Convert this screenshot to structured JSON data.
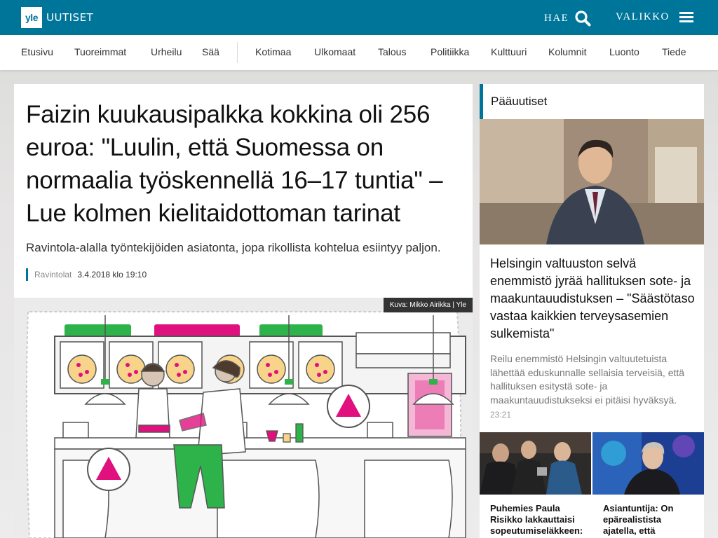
{
  "header": {
    "logo_badge": "yle",
    "logo_text": "UUTISET",
    "search_label": "HAE",
    "menu_label": "VALIKKO"
  },
  "nav": {
    "items": [
      "Etusivu",
      "Tuoreimmat",
      "Urheilu",
      "Sää",
      "Kotimaa",
      "Ulkomaat",
      "Talous",
      "Politiikka",
      "Kulttuuri",
      "Kolumnit",
      "Luonto",
      "Tiede"
    ]
  },
  "article": {
    "headline": "Faizin kuukausipalkka kokkina oli 256 euroa: \"Luulin, että Suomessa on normaalia työskennellä 16–17 tuntia\" – Lue kolmen kielitaidottoman tarinat",
    "lead": "Ravintola-alalla työntekijöiden asiatonta, jopa rikollista kohtelua esiintyy paljon.",
    "category": "Ravintolat",
    "timestamp": "3.4.2018 klo 19:10",
    "image_caption": "Kuva: Mikko Airikka | Yle"
  },
  "sidebar": {
    "heading": "Pääuutiset",
    "top_story": {
      "title": "Helsingin valtuuston selvä enemmistö jyrää hallituksen sote- ja maakuntauudistuksen – \"Säästötaso vastaa kaikkien terveysasemien sulkemista\"",
      "lead": "Reilu enemmistö Helsingin valtuutetuista lähettää eduskunnalle sellaisia terveisiä, että hallituksen esitystä sote- ja maakuntauudistukseksi ei pitäisi hyväksyä.",
      "time": "23:21"
    },
    "grid": [
      {
        "title": "Puhemies Paula Risikko lakkauttaisi sopeutumiseläkkeen:"
      },
      {
        "title": "Asiantuntija: On epärealistista ajatella, että"
      }
    ]
  },
  "colors": {
    "brand": "#00759a",
    "accent_pink": "#e0107e",
    "accent_green": "#2db34a"
  }
}
